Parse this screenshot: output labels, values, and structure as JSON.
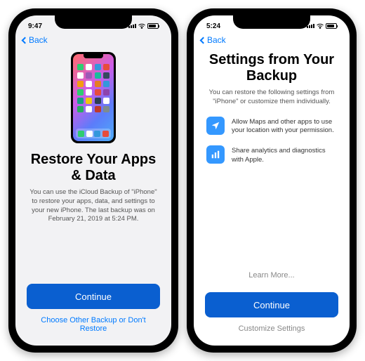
{
  "left": {
    "status_time": "9:47",
    "back_label": "Back",
    "title": "Restore Your Apps & Data",
    "description": "You can use the iCloud Backup of \"iPhone\" to restore your apps, data, and settings to your new iPhone. The last backup was on February 21, 2019 at 5:24 PM.",
    "continue": "Continue",
    "alt_link": "Choose Other Backup or Don't Restore"
  },
  "right": {
    "status_time": "5:24",
    "back_label": "Back",
    "title": "Settings from Your Backup",
    "description": "You can restore the following settings from \"iPhone\" or customize them individually.",
    "items": [
      {
        "icon": "location-arrow",
        "text": "Allow Maps and other apps to use your location with your permission."
      },
      {
        "icon": "analytics-bars",
        "text": "Share analytics and diagnostics with Apple."
      }
    ],
    "learn_more": "Learn More...",
    "continue": "Continue",
    "customize": "Customize Settings"
  },
  "colors": {
    "accent": "#007aff",
    "primary_btn": "#0a5fd0"
  }
}
